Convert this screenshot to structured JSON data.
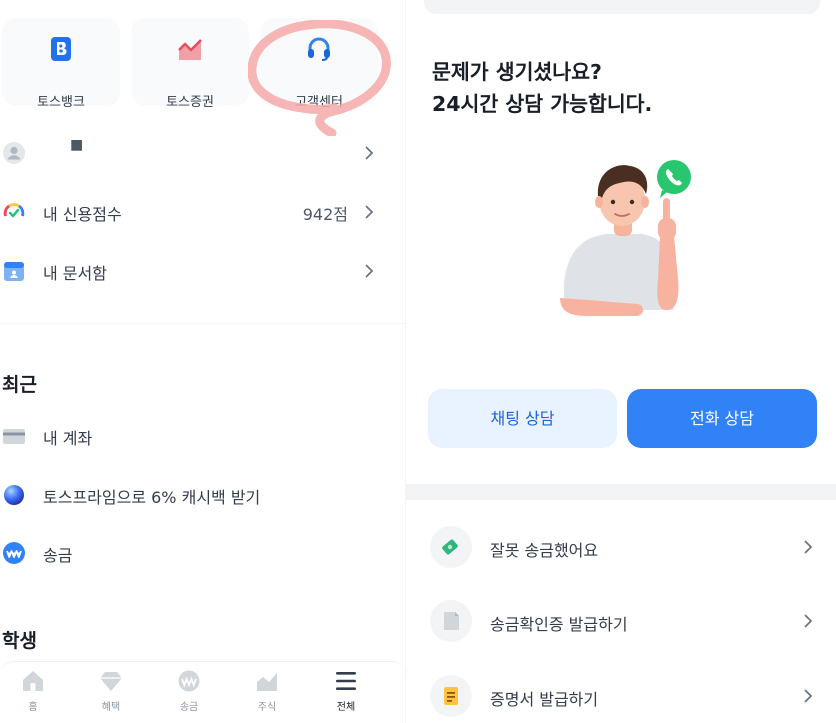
{
  "left": {
    "quick_tiles": [
      {
        "label": "토스뱅크",
        "icon": "toss-bank-icon"
      },
      {
        "label": "토스증권",
        "icon": "toss-securities-icon"
      },
      {
        "label": "고객센터",
        "icon": "headset-icon"
      }
    ],
    "profile": {
      "name": "■",
      "icon": "avatar-icon"
    },
    "menu": [
      {
        "label": "내 신용점수",
        "value": "942점",
        "icon": "credit-gauge-icon"
      },
      {
        "label": "내 문서함",
        "icon": "document-box-icon"
      }
    ],
    "recent_title": "최근",
    "recent": [
      {
        "label": "내 계좌",
        "icon": "card-icon"
      },
      {
        "label": "토스프라임으로 6% 캐시백 받기",
        "icon": "prime-orb-icon"
      },
      {
        "label": "송금",
        "icon": "transfer-icon"
      }
    ],
    "student_title": "학생",
    "tabs": [
      {
        "label": "홈",
        "icon": "home-icon"
      },
      {
        "label": "혜택",
        "icon": "benefit-icon"
      },
      {
        "label": "송금",
        "icon": "transfer-icon"
      },
      {
        "label": "주식",
        "icon": "stock-icon"
      },
      {
        "label": "전체",
        "icon": "menu-icon",
        "active": true
      }
    ]
  },
  "right": {
    "headline_line1": "문제가 생기셨나요?",
    "headline_line2": "24시간 상담 가능합니다.",
    "chat_button": "채팅 상담",
    "call_button": "전화 상담",
    "help_items": [
      {
        "label": "잘못 송금했어요",
        "icon": "wrong-transfer-icon"
      },
      {
        "label": "송금확인증 발급하기",
        "icon": "receipt-icon"
      },
      {
        "label": "증명서 발급하기",
        "icon": "certificate-icon"
      }
    ]
  },
  "colors": {
    "primary": "#3182f6",
    "primary_light": "#e8f3ff",
    "annotation": "#f4a9a8",
    "text": "#191f28",
    "subtle_bg": "#f2f4f6"
  }
}
